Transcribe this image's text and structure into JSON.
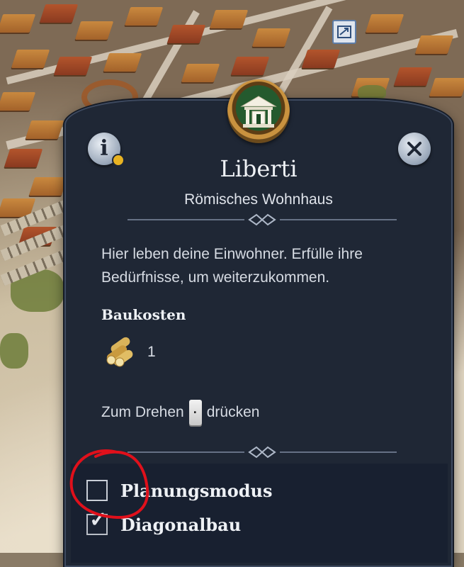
{
  "building": {
    "title": "Liberti",
    "subtitle": "Römisches Wohnhaus",
    "description": "Hier leben deine Einwohner. Erfülle ihre Bedürfnisse, um weiterzukommen.",
    "cost_label": "Baukosten",
    "cost_value": "1",
    "cost_icon": "wood-logs-icon"
  },
  "hint": {
    "before": "Zum Drehen",
    "key": "·",
    "after": "drücken"
  },
  "options": [
    {
      "label": "Planungsmodus",
      "checked": false
    },
    {
      "label": "Diagonalbau",
      "checked": true
    }
  ],
  "colors": {
    "panel": "#1f2735",
    "emblem_green": "#245a2e",
    "gold": "#c9923f",
    "annotation": "#e0101b",
    "notification_dot": "#e8b322"
  }
}
